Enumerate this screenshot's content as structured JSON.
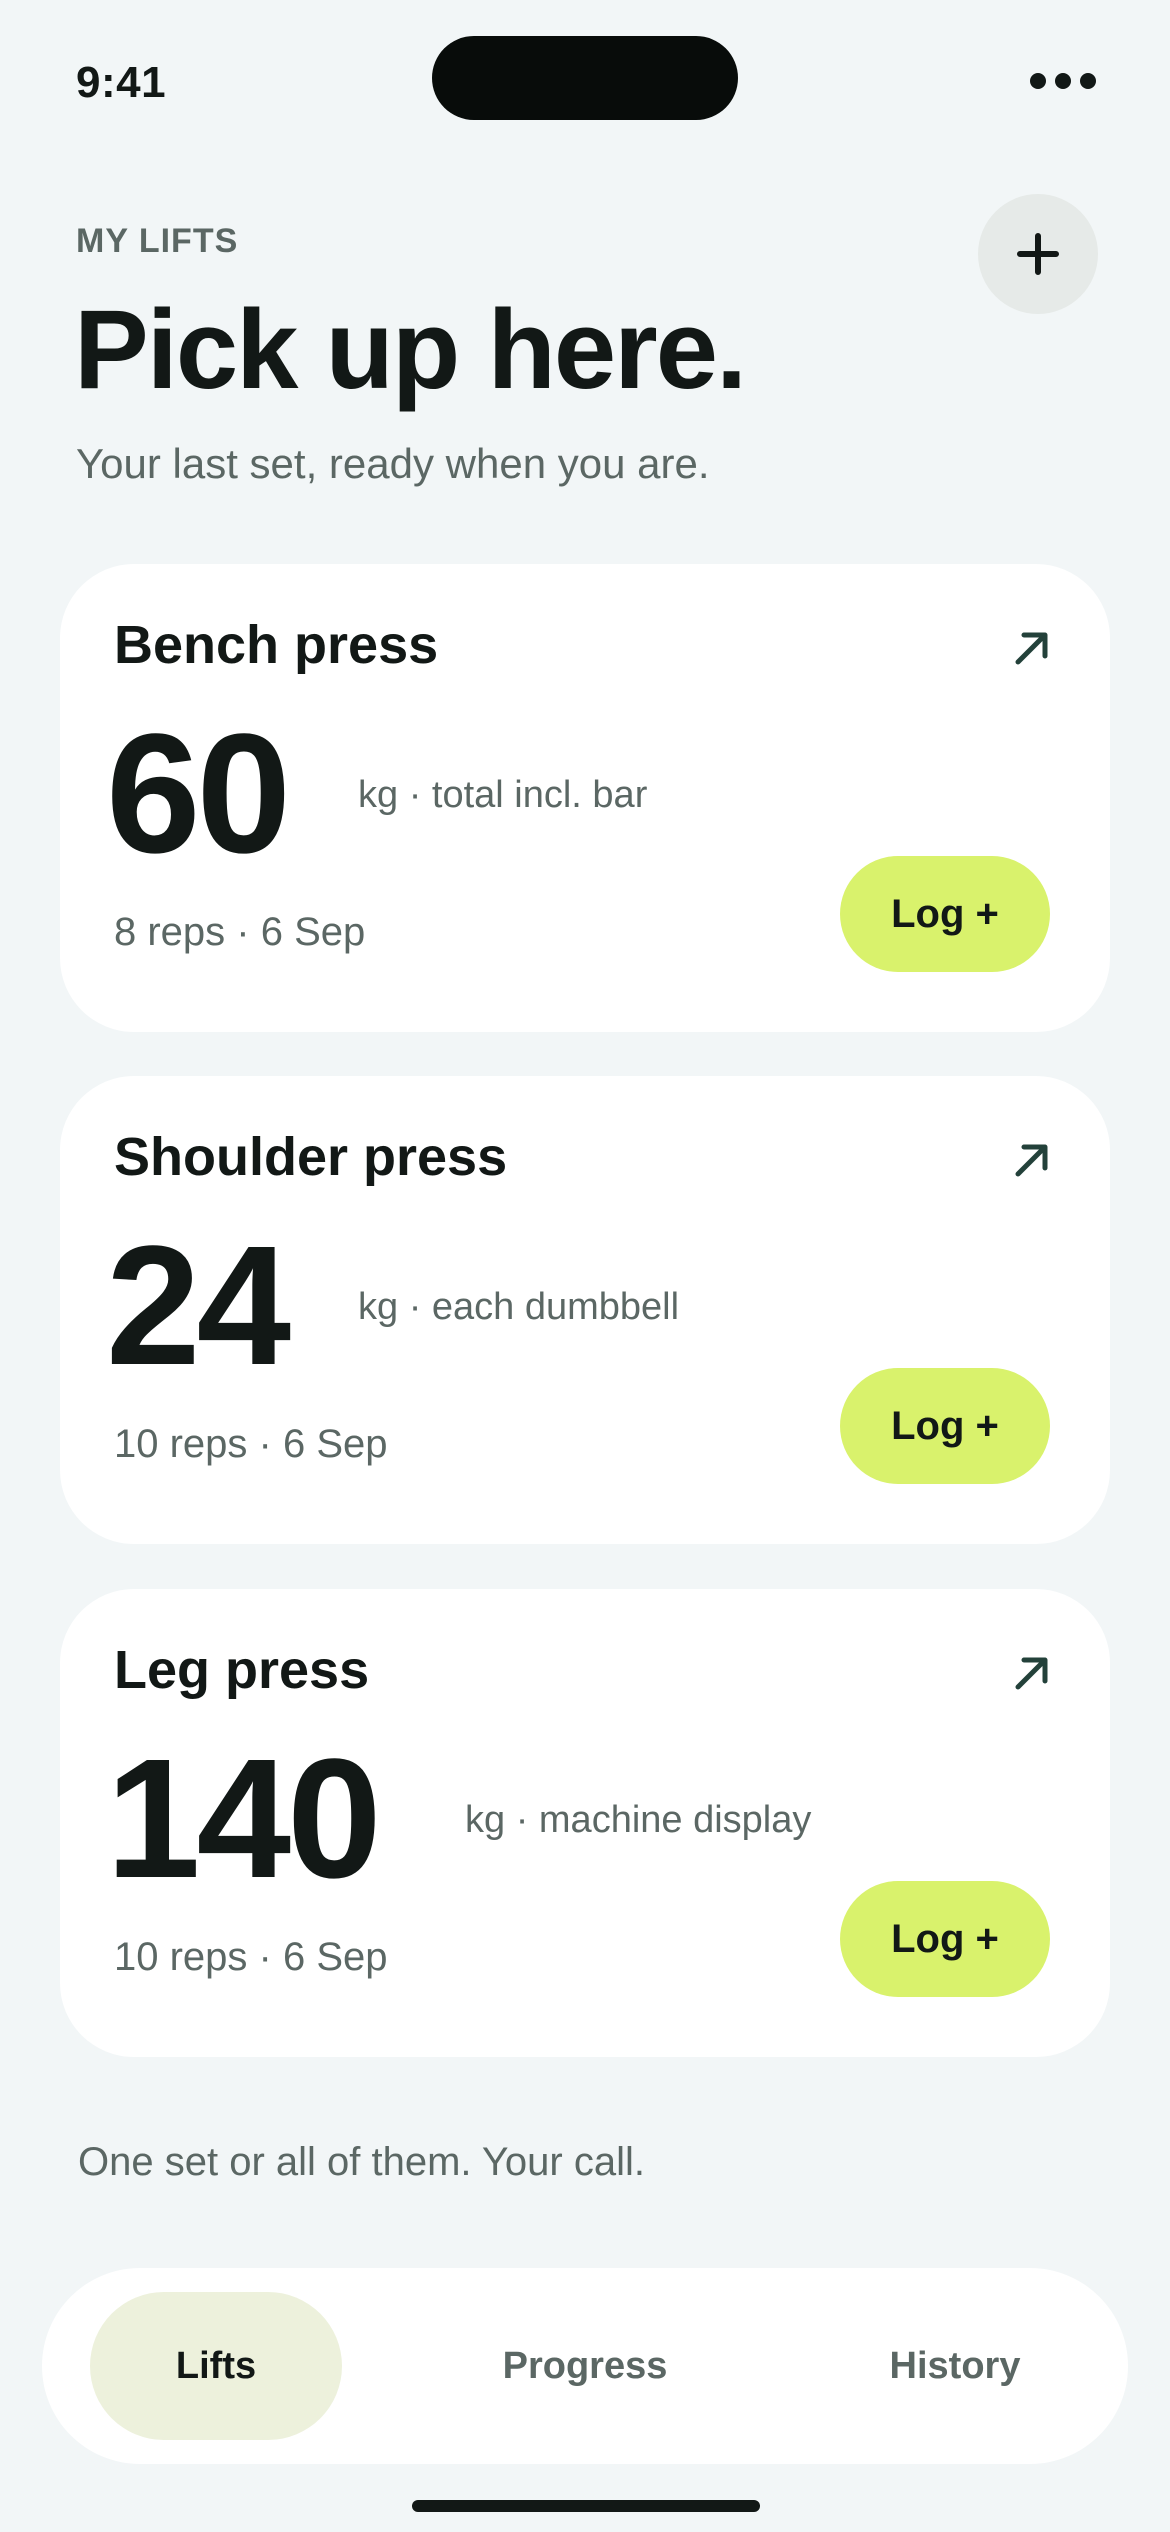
{
  "status_bar": {
    "time": "9:41"
  },
  "header": {
    "eyebrow": "MY LIFTS",
    "title": "Pick up here.",
    "subtitle": "Your last set, ready when you are."
  },
  "icons": {
    "add": "plus-icon",
    "open": "arrow-up-right-icon",
    "more": "more-horizontal-icon"
  },
  "lifts": [
    {
      "name": "Bench press",
      "weight": "60",
      "unit": "kg · total incl. bar",
      "meta": "8 reps · 6 Sep",
      "log_label": "Log +"
    },
    {
      "name": "Shoulder press",
      "weight": "24",
      "unit": "kg · each dumbbell",
      "meta": "10 reps · 6 Sep",
      "log_label": "Log +"
    },
    {
      "name": "Leg press",
      "weight": "140",
      "unit": "kg · machine display",
      "meta": "10 reps · 6 Sep",
      "log_label": "Log +"
    }
  ],
  "footnote": "One set or all of them. Your call.",
  "tabs": [
    {
      "label": "Lifts",
      "active": true
    },
    {
      "label": "Progress",
      "active": false
    },
    {
      "label": "History",
      "active": false
    }
  ],
  "colors": {
    "background": "#f2f6f7",
    "card": "#ffffff",
    "accent": "#d9f26c",
    "active_tab": "#edf1dc",
    "muted_text": "#5b6764",
    "text": "#121816"
  }
}
